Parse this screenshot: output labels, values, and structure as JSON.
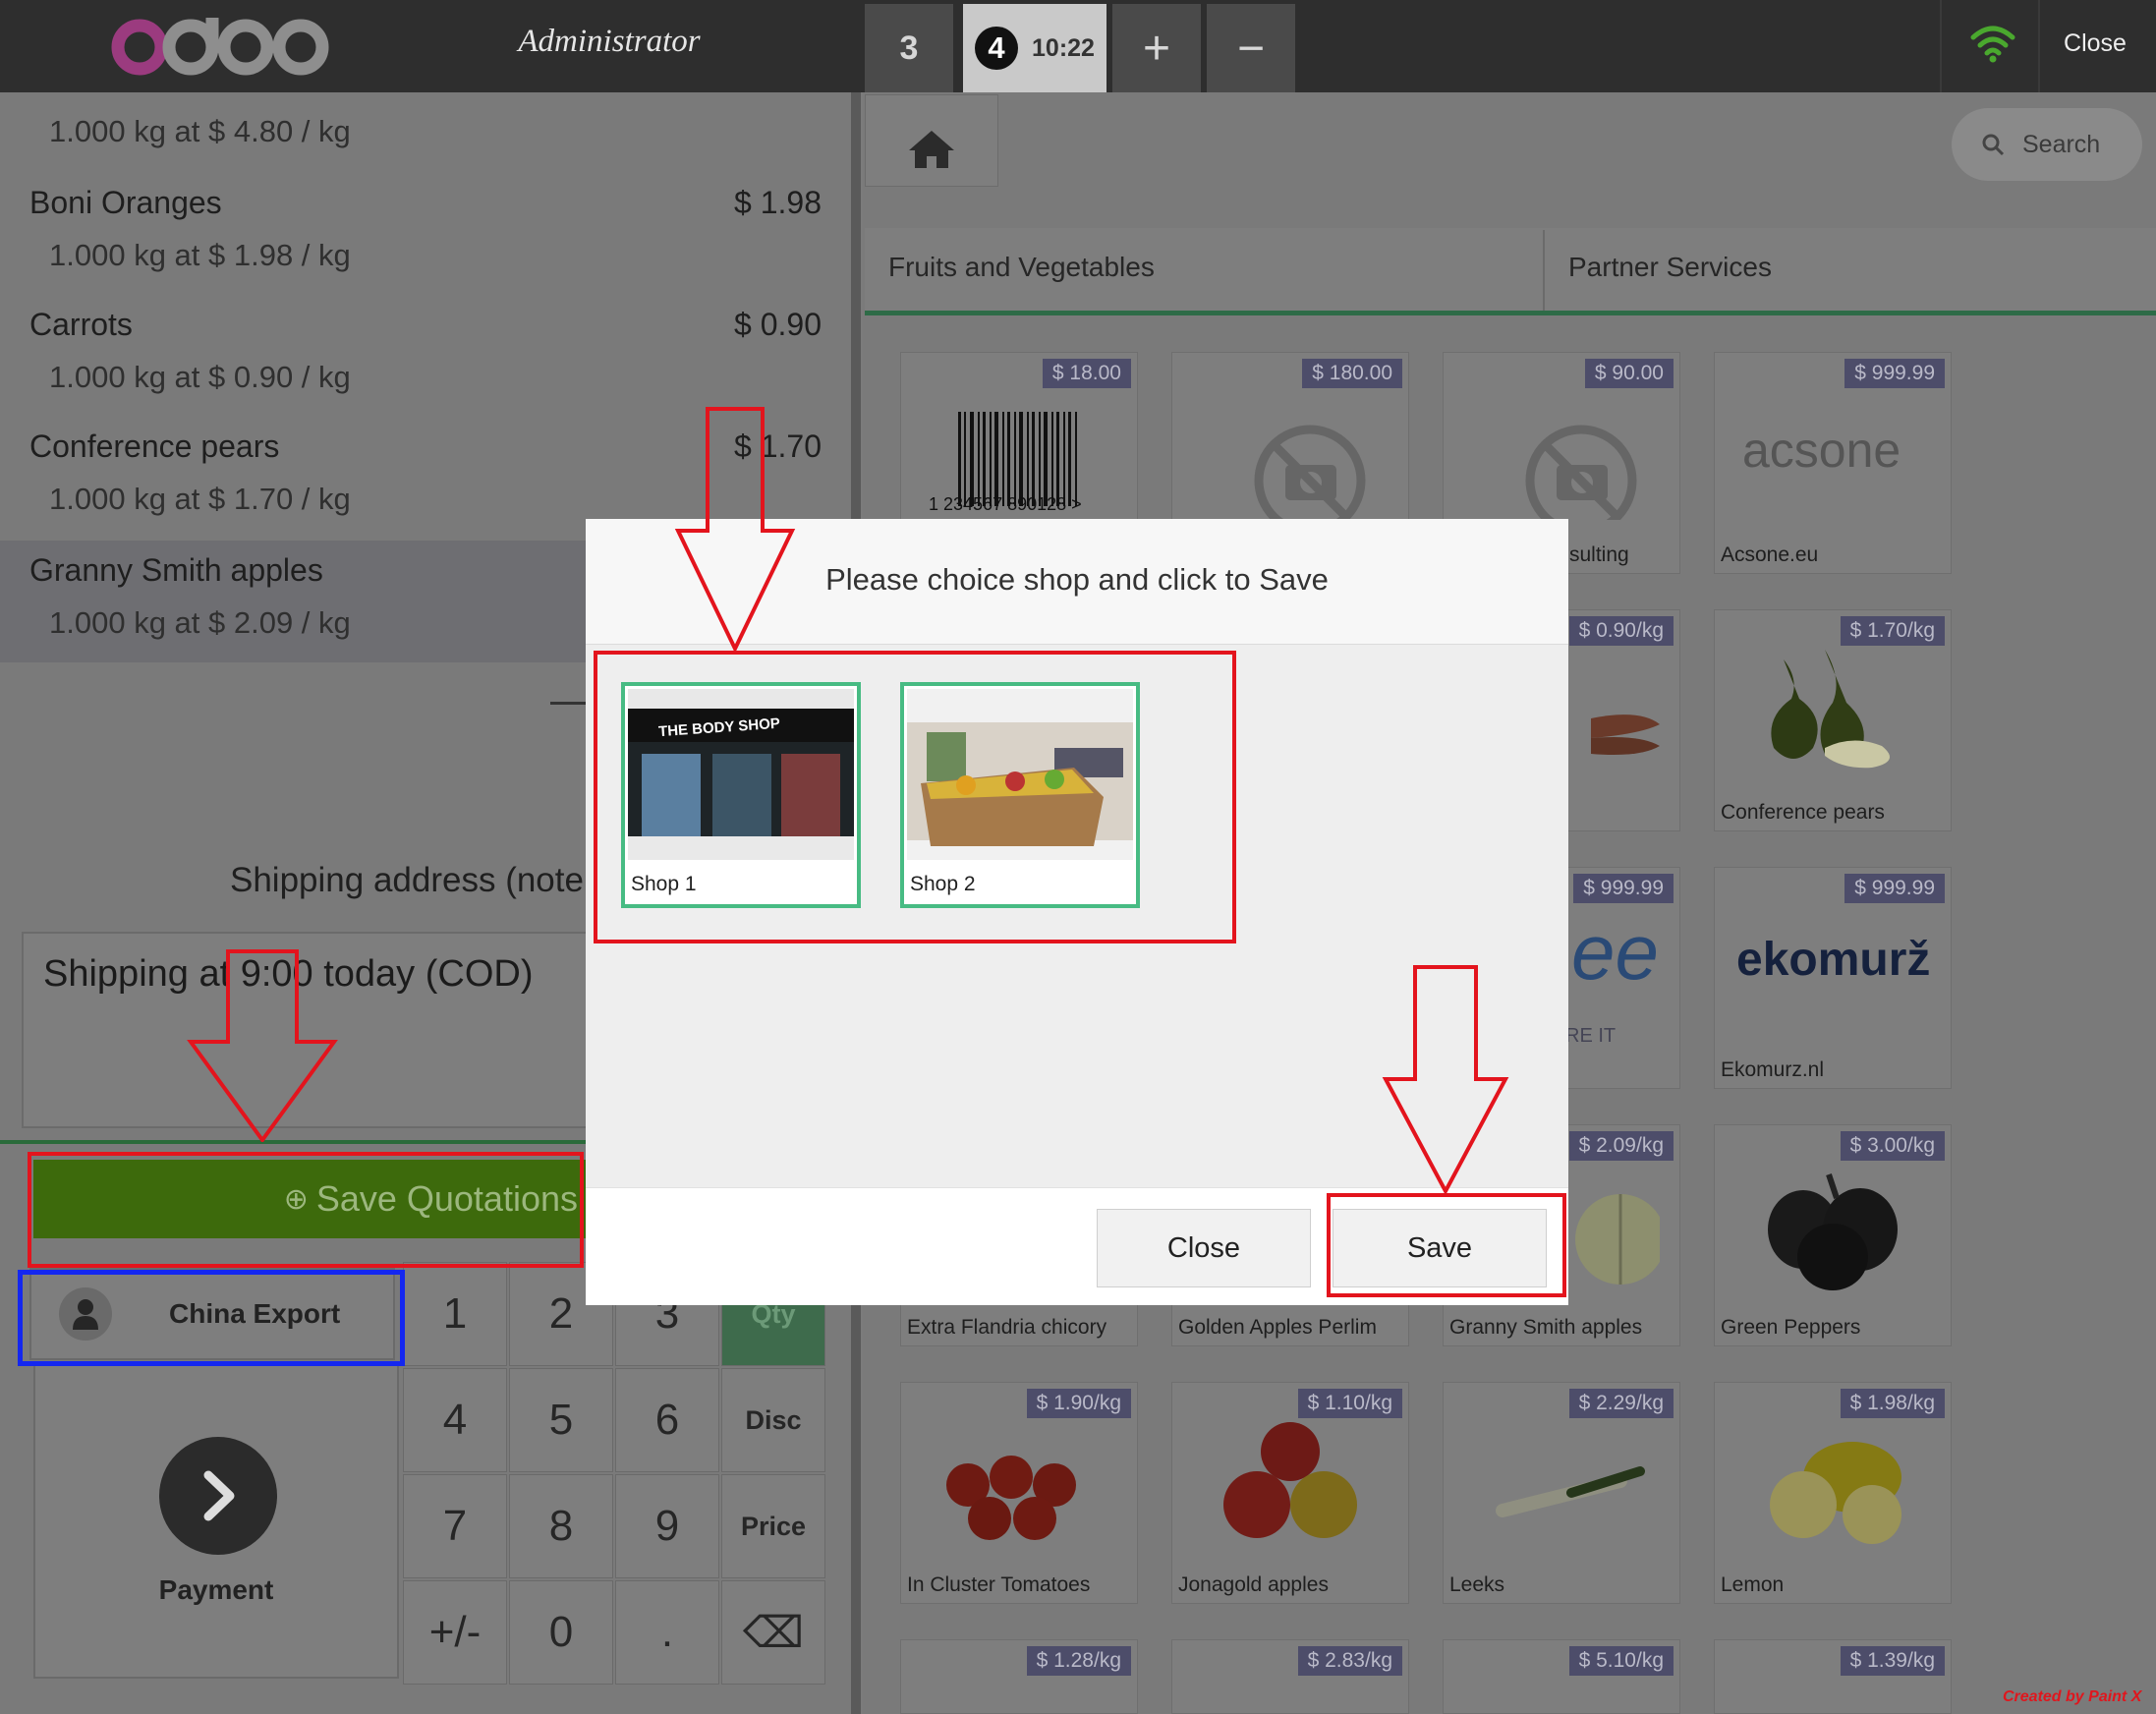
{
  "header": {
    "brand": "odoo",
    "user": "Administrator",
    "tabs": [
      {
        "label": "3"
      },
      {
        "label": "4",
        "time": "10:22"
      }
    ],
    "add_label": "+",
    "remove_label": "−",
    "close_label": "Close"
  },
  "order": {
    "lines": [
      {
        "detail": "1.000 kg at $ 4.80 / kg"
      },
      {
        "name": "Boni Oranges",
        "price": "$ 1.98",
        "detail": "1.000 kg at $ 1.98 / kg"
      },
      {
        "name": "Carrots",
        "price": "$ 0.90",
        "detail": "1.000 kg at $ 0.90 / kg"
      },
      {
        "name": "Conference pears",
        "price": "$ 1.70",
        "detail": "1.000 kg at $ 1.70 / kg"
      },
      {
        "name": "Granny Smith apples",
        "detail": "1.000 kg at $ 2.09 / kg",
        "selected": true
      }
    ],
    "shipping_label": "Shipping address (note",
    "shipping_value": "Shipping at 9:00 today (COD)",
    "save_quotations": "Save Quotations",
    "customer": "China Export",
    "payment": "Payment"
  },
  "numpad": {
    "keys": [
      "1",
      "2",
      "3",
      "Qty",
      "4",
      "5",
      "6",
      "Disc",
      "7",
      "8",
      "9",
      "Price",
      "+/-",
      "0",
      ".",
      "⌫"
    ]
  },
  "products": {
    "search_label": "Search",
    "categories": [
      "Fruits and Vegetables",
      "Partner Services"
    ],
    "cards": [
      {
        "price": "$ 18.00",
        "name": "",
        "barcode": "1 234567 890128 >"
      },
      {
        "price": "$ 180.00",
        "name": ""
      },
      {
        "price": "$ 90.00",
        "name": "sulting"
      },
      {
        "price": "$ 999.99",
        "name": "Acsone.eu",
        "logo": "acsone"
      },
      {
        "price": "$ 0.90/kg",
        "name": ""
      },
      {
        "price": "$ 1.70/kg",
        "name": "Conference pears"
      },
      {
        "price": "$ 999.99",
        "name": "",
        "fragment": "RE IT"
      },
      {
        "price": "$ 999.99",
        "name": "Ekomurz.nl",
        "logo": "ekomurž"
      },
      {
        "price": "",
        "name": "Extra Flandria chicory"
      },
      {
        "price": "",
        "name": "Golden Apples Perlim"
      },
      {
        "price": "$ 2.09/kg",
        "name": "Granny Smith apples"
      },
      {
        "price": "$ 3.00/kg",
        "name": "Green Peppers"
      },
      {
        "price": "$ 1.90/kg",
        "name": "In Cluster Tomatoes"
      },
      {
        "price": "$ 1.10/kg",
        "name": "Jonagold apples"
      },
      {
        "price": "$ 2.29/kg",
        "name": "Leeks"
      },
      {
        "price": "$ 1.98/kg",
        "name": "Lemon"
      },
      {
        "price": "$ 1.28/kg",
        "name": ""
      },
      {
        "price": "$ 2.83/kg",
        "name": ""
      },
      {
        "price": "$ 5.10/kg",
        "name": ""
      },
      {
        "price": "$ 1.39/kg",
        "name": ""
      }
    ]
  },
  "modal": {
    "title": "Please choice shop and click to Save",
    "shops": [
      {
        "name": "Shop 1",
        "sign": "THE BODY SHOP"
      },
      {
        "name": "Shop 2"
      }
    ],
    "close_label": "Close",
    "save_label": "Save"
  },
  "credit": "Created by Paint X",
  "colors": {
    "annotation_red": "#e3141d",
    "annotation_blue": "#1427f0",
    "shop_border": "#47bb83",
    "save_quotations_green": "#3d6a0c"
  }
}
